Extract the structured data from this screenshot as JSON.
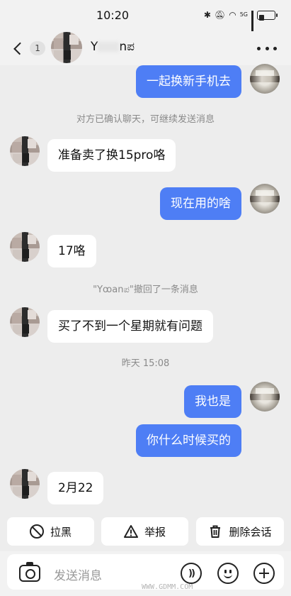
{
  "status_bar": {
    "time": "10:20",
    "network_label": "5G",
    "battery_level": 0.35
  },
  "header": {
    "back_label": "<",
    "unread_count": "1",
    "contact_name": "Y▒▒anಪ",
    "more_icon": "more-horizontal-icon"
  },
  "messages": [
    {
      "side": "out",
      "text": "一起换新手机去"
    },
    {
      "side": "system",
      "text": "对方已确认聊天，可继续发送消息"
    },
    {
      "side": "in",
      "text": "准备卖了换15pro咯"
    },
    {
      "side": "out",
      "text": "现在用的啥"
    },
    {
      "side": "in",
      "text": "17咯"
    },
    {
      "side": "system",
      "text": "\"Yರanಪ\"撤回了一条消息"
    },
    {
      "side": "in",
      "text": "买了不到一个星期就有问题"
    },
    {
      "side": "system",
      "text": "昨天 15:08"
    },
    {
      "side": "out",
      "text": "我也是"
    },
    {
      "side": "out",
      "text": "你什么时候买的"
    },
    {
      "side": "in",
      "text": "2月22"
    }
  ],
  "actions": {
    "block_label": "拉黑",
    "report_label": "举报",
    "delete_label": "删除会话"
  },
  "input": {
    "placeholder": "发送消息"
  },
  "watermark": {
    "url": "WWW.GDMM.COM"
  },
  "colors": {
    "outgoing_bubble": "#4e7ef5",
    "background": "#ededed"
  }
}
